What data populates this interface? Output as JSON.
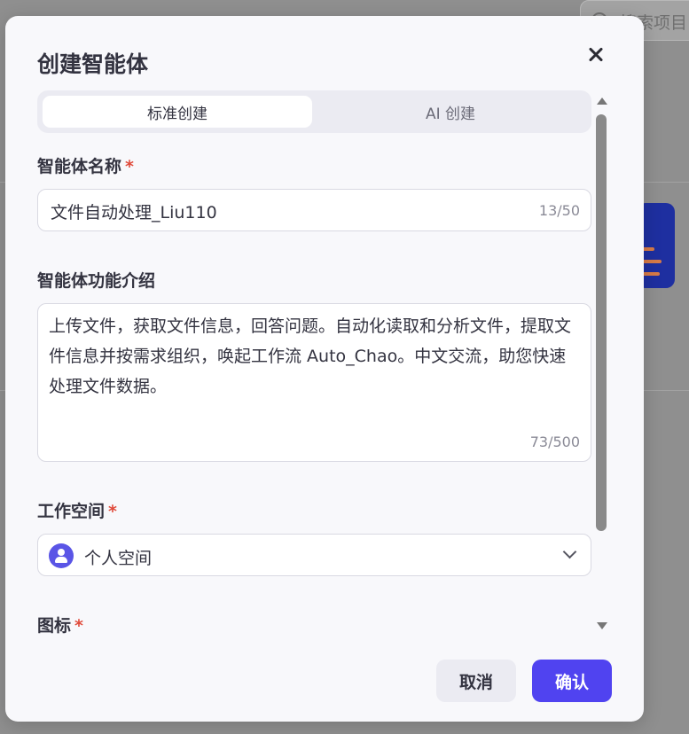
{
  "background": {
    "search_placeholder": "搜索项目"
  },
  "dialog": {
    "title": "创建智能体",
    "tabs": [
      {
        "label": "标准创建",
        "active": true
      },
      {
        "label": "AI 创建",
        "active": false
      }
    ],
    "name_field": {
      "label": "智能体名称",
      "required_mark": "*",
      "value": "文件自动处理_Liu110",
      "counter": "13/50"
    },
    "description_field": {
      "label": "智能体功能介绍",
      "value": "上传文件，获取文件信息，回答问题。自动化读取和分析文件，提取文件信息并按需求组织，唤起工作流 Auto_Chao。中文交流，助您快速处理文件数据。",
      "counter": "73/500"
    },
    "workspace_field": {
      "label": "工作空间",
      "required_mark": "*",
      "value": "个人空间",
      "avatar_icon": "user-icon",
      "dropdown_icon": "chevron-down-icon"
    },
    "icon_field": {
      "label": "图标",
      "required_mark": "*"
    },
    "buttons": {
      "cancel": "取消",
      "confirm": "确认"
    }
  },
  "colors": {
    "accent": "#5043f0",
    "required": "#e04a3a",
    "dialog_bg": "#f8f8fb"
  }
}
